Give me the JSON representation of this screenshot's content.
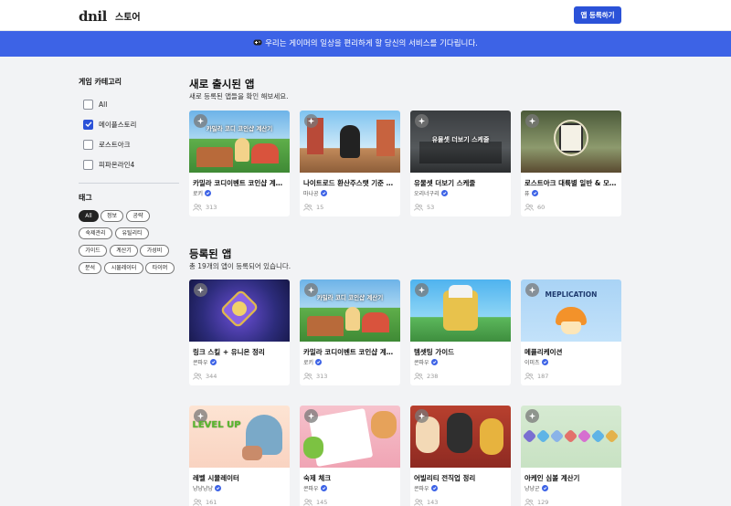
{
  "header": {
    "logo": "dnil",
    "store": "스토어",
    "register_button": "앱 등록하기"
  },
  "banner": {
    "text": "우리는 게이머의 일상을 편리하게 할 당신의 서비스를 기다립니다."
  },
  "sidebar": {
    "category_title": "게임 카테고리",
    "categories": [
      {
        "label": "All",
        "checked": false
      },
      {
        "label": "메이플스토리",
        "checked": true
      },
      {
        "label": "로스트아크",
        "checked": false
      },
      {
        "label": "피파온라인4",
        "checked": false
      }
    ],
    "tags_title": "태그",
    "tags": [
      {
        "label": "All",
        "active": true
      },
      {
        "label": "정보",
        "active": false
      },
      {
        "label": "공략",
        "active": false
      },
      {
        "label": "숙제관리",
        "active": false
      },
      {
        "label": "유틸리티",
        "active": false
      },
      {
        "label": "가이드",
        "active": false
      },
      {
        "label": "계산기",
        "active": false
      },
      {
        "label": "가성비",
        "active": false
      },
      {
        "label": "분석",
        "active": false
      },
      {
        "label": "시뮬레이터",
        "active": false
      },
      {
        "label": "타이머",
        "active": false
      }
    ]
  },
  "new_apps": {
    "title": "새로 출시된 앱",
    "subtitle": "새로 등록된 앱들을 확인 해보세요.",
    "cards": [
      {
        "title": "카밀라 코디이벤트 코인샵 계산기",
        "author": "로키",
        "users": "313",
        "thumb_text": "카밀라 코디 코인샵 계산기",
        "theme": "maple"
      },
      {
        "title": "나이트로드 환산주스탯 기준 기...",
        "author": "마나공",
        "users": "15",
        "thumb_text": "",
        "theme": "night"
      },
      {
        "title": "유물셋 더보기 스케줄",
        "author": "오리너구리",
        "users": "53",
        "thumb_text": "유물셋 더보기 스케줄",
        "theme": "dark"
      },
      {
        "title": "로스트아크 대륙별 일반 & 모험 ...",
        "author": "퓨",
        "users": "60",
        "thumb_text": "",
        "theme": "ark"
      }
    ]
  },
  "registered_apps": {
    "title": "등록된 앱",
    "subtitle": "총 19개의 앱이 등록되어 있습니다.",
    "cards": [
      {
        "title": "링크 스킬 + 유니온 정리",
        "author": "콘파우",
        "users": "344",
        "thumb_text": "",
        "theme": "link"
      },
      {
        "title": "카밀라 코디이벤트 코인샵 계산기",
        "author": "로키",
        "users": "313",
        "thumb_text": "카밀라 코디 코인샵 계산기",
        "theme": "maple"
      },
      {
        "title": "템셋팅 가이드",
        "author": "콘파우",
        "users": "238",
        "thumb_text": "",
        "theme": "sky"
      },
      {
        "title": "메플리케이션",
        "author": "이미츠",
        "users": "187",
        "thumb_text": "MEPLICATION",
        "theme": "meplication"
      },
      {
        "title": "레벨 시뮬레이터",
        "author": "냥냥냥냥",
        "users": "161",
        "thumb_text": "LEVEL UP",
        "theme": "levelup"
      },
      {
        "title": "숙제 체크",
        "author": "콘파우",
        "users": "145",
        "thumb_text": "",
        "theme": "calendar"
      },
      {
        "title": "어빌리티 전직업 정리",
        "author": "콘파우",
        "users": "143",
        "thumb_text": "",
        "theme": "chars"
      },
      {
        "title": "아케인 심볼 계산기",
        "author": "냥냥군",
        "users": "129",
        "thumb_text": "",
        "theme": "arcane"
      }
    ]
  }
}
